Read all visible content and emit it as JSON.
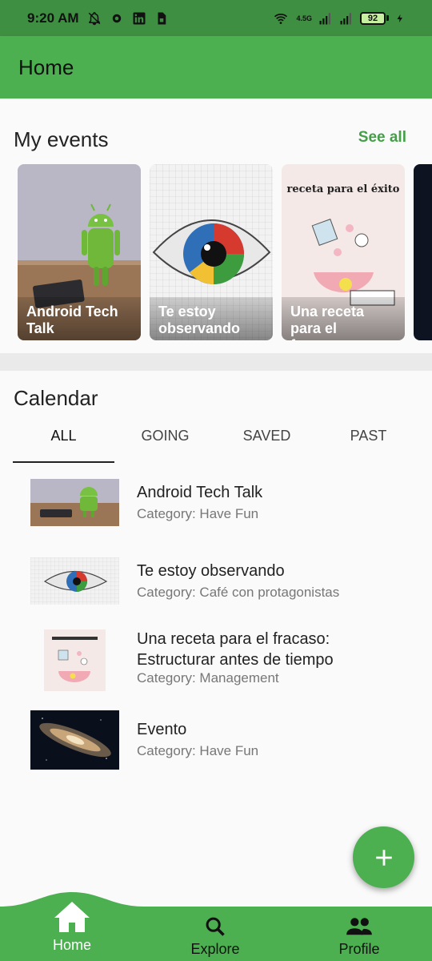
{
  "status_bar": {
    "time": "9:20 AM",
    "network": "4.5G",
    "battery": "92"
  },
  "app_bar": {
    "title": "Home"
  },
  "my_events": {
    "title": "My events",
    "see_all": "See all",
    "cards": [
      {
        "title": "Android Tech Talk"
      },
      {
        "title": "Te estoy observando"
      },
      {
        "title": "Una receta para el fracaso:"
      }
    ],
    "card3_image": {
      "heading": "receta para el éxito"
    }
  },
  "calendar": {
    "title": "Calendar",
    "tabs": [
      "ALL",
      "GOING",
      "SAVED",
      "PAST"
    ],
    "active_tab": "ALL",
    "events": [
      {
        "title": "Android Tech Talk",
        "category": "Category: Have Fun"
      },
      {
        "title": "Te estoy observando",
        "category": "Category: Café con protagonistas"
      },
      {
        "title": "Una receta para el fracaso: Estructurar antes de tiempo",
        "category": "Category: Management"
      },
      {
        "title": "Evento",
        "category": "Category: Have Fun"
      }
    ]
  },
  "bottom_nav": {
    "items": [
      {
        "label": "Home",
        "icon": "home-icon"
      },
      {
        "label": "Explore",
        "icon": "search-icon"
      },
      {
        "label": "Profile",
        "icon": "people-icon"
      }
    ],
    "active": "Home"
  },
  "colors": {
    "primary": "#4caf50",
    "status_bar": "#3f8f43",
    "accent_text": "#43a047"
  }
}
